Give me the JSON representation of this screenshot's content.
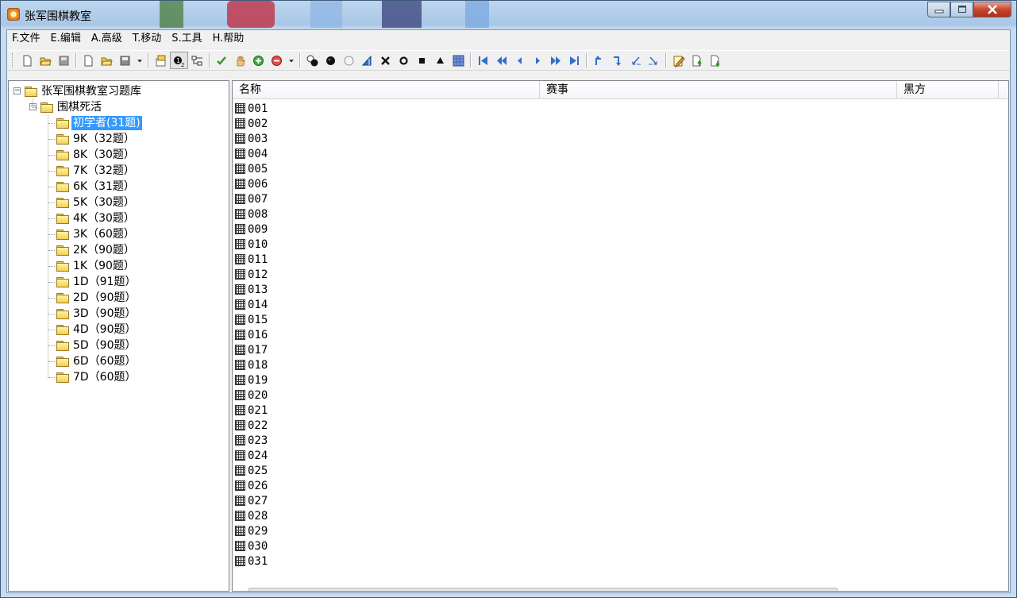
{
  "window": {
    "title": "张军围棋教室"
  },
  "menu": [
    "F.文件",
    "E.编辑",
    "A.高级",
    "T.移动",
    "S.工具",
    "H.帮助"
  ],
  "toolbar_icons": [
    "new-file-icon",
    "open-folder-icon",
    "save-disabled-icon",
    "|",
    "new-file-icon",
    "open-folder-icon",
    "save-icon",
    "dropdown-arrow-icon",
    "|",
    "properties-icon",
    "move-number-icon",
    "tree-view-icon",
    "|",
    "checkmark-icon",
    "hand-icon",
    "add-icon",
    "remove-icon",
    "dropdown-arrow-icon",
    "|",
    "alternate-stones-icon",
    "black-stone-icon",
    "white-stone-icon",
    "triangle-flag-icon",
    "cross-mark-icon",
    "circle-mark-icon",
    "square-mark-icon",
    "triangle-mark-icon",
    "shade-icon",
    "|",
    "first-move-icon",
    "fast-back-icon",
    "back-icon",
    "forward-icon",
    "fast-forward-icon",
    "last-move-icon",
    "|",
    "branch-up-icon",
    "branch-down-icon",
    "branch-left-icon",
    "branch-right-icon",
    "|",
    "edit-comment-icon",
    "export-up-icon",
    "export-down-icon"
  ],
  "tree": {
    "root": "张军围棋教室习题库",
    "group": "围棋死活",
    "items": [
      "初学者(31题)",
      "9K（32题）",
      "8K（30题）",
      "7K（32题）",
      "6K（31题）",
      "5K（30题）",
      "4K（30题）",
      "3K（60题）",
      "2K（90题）",
      "1K（90题）",
      "1D（91题）",
      "2D（90题）",
      "3D（90题）",
      "4D（90题）",
      "5D（90题）",
      "6D（60题）",
      "7D（60题）"
    ],
    "selected_index": 0
  },
  "list": {
    "columns": [
      "名称",
      "赛事",
      "黑方"
    ],
    "rows": [
      "001",
      "002",
      "003",
      "004",
      "005",
      "006",
      "007",
      "008",
      "009",
      "010",
      "011",
      "012",
      "013",
      "014",
      "015",
      "016",
      "017",
      "018",
      "019",
      "020",
      "021",
      "022",
      "023",
      "024",
      "025",
      "026",
      "027",
      "028",
      "029",
      "030",
      "031"
    ]
  },
  "colors": {
    "selection": "#3399ff",
    "close_button": "#c6462d"
  }
}
